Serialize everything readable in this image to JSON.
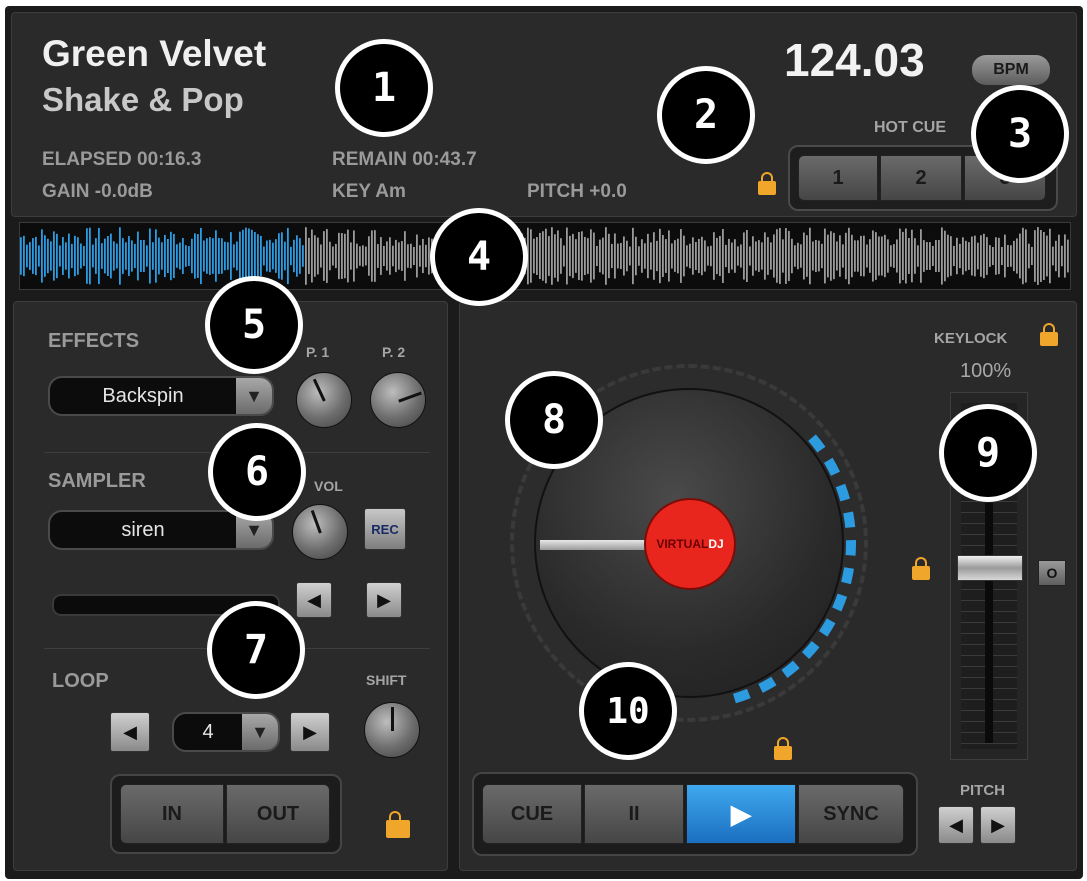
{
  "track": {
    "artist": "Green Velvet",
    "title": "Shake & Pop"
  },
  "bpm": {
    "value": "124.03",
    "badge": "BPM"
  },
  "info": {
    "elapsed": "ELAPSED 00:16.3",
    "remain": "REMAIN 00:43.7",
    "gain": "GAIN -0.0dB",
    "key": "KEY Am",
    "pitch": "PITCH +0.0"
  },
  "hotcue": {
    "label": "HOT CUE",
    "buttons": [
      "1",
      "2",
      "3"
    ]
  },
  "waveform": {
    "progress": 0.27
  },
  "effects": {
    "label": "EFFECTS",
    "value": "Backspin",
    "p1": "P. 1",
    "p2": "P. 2"
  },
  "sampler": {
    "label": "SAMPLER",
    "value": "siren",
    "vol": "VOL",
    "rec": "REC"
  },
  "loop": {
    "label": "LOOP",
    "value": "4",
    "shift": "SHIFT",
    "in": "IN",
    "out": "OUT"
  },
  "platter": {
    "logo_a": "VIRTUAL",
    "logo_b": "DJ"
  },
  "pitch_panel": {
    "keylock": "KEYLOCK",
    "percent": "100%",
    "zero": "O",
    "pitch": "PITCH"
  },
  "transport": {
    "cue": "CUE",
    "pause": "II",
    "play": "▶",
    "sync": "SYNC"
  },
  "callouts": [
    "1",
    "2",
    "3",
    "4",
    "5",
    "6",
    "7",
    "8",
    "9",
    "10"
  ],
  "colors": {
    "accent": "#2d9be0",
    "lock": "#f0a62a",
    "record": "#e8261e"
  }
}
